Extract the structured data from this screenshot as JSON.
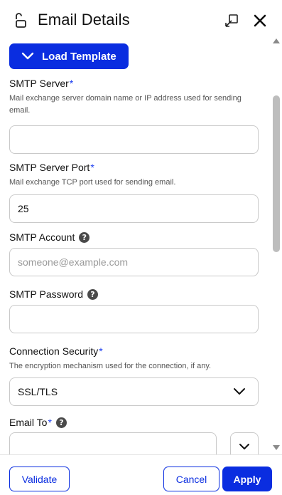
{
  "header": {
    "title": "Email Details",
    "lock_icon": "unlock-icon",
    "popout_icon": "popout-icon",
    "close_icon": "close-icon"
  },
  "load_template": {
    "label": "Load Template",
    "icon": "chevron-down-icon"
  },
  "fields": {
    "smtp_server": {
      "label": "SMTP Server",
      "required_mark": "*",
      "description": "Mail exchange server domain name or IP address used for sending email.",
      "value": ""
    },
    "smtp_port": {
      "label": "SMTP Server Port",
      "required_mark": "*",
      "description": "Mail exchange TCP port used for sending email.",
      "value": "25"
    },
    "smtp_account": {
      "label": "SMTP Account",
      "help": "?",
      "placeholder": "someone@example.com",
      "value": ""
    },
    "smtp_password": {
      "label": "SMTP Password",
      "help": "?",
      "value": ""
    },
    "connection_security": {
      "label": "Connection Security",
      "required_mark": "*",
      "description": "The encryption mechanism used for the connection, if any.",
      "value": "SSL/TLS"
    },
    "email_to": {
      "label": "Email To",
      "required_mark": "*",
      "help": "?",
      "value": ""
    }
  },
  "footer": {
    "validate_label": "Validate",
    "cancel_label": "Cancel",
    "apply_label": "Apply"
  },
  "colors": {
    "primary": "#0a2de0",
    "required": "#1a3cf0",
    "border": "#c9c9c9"
  }
}
